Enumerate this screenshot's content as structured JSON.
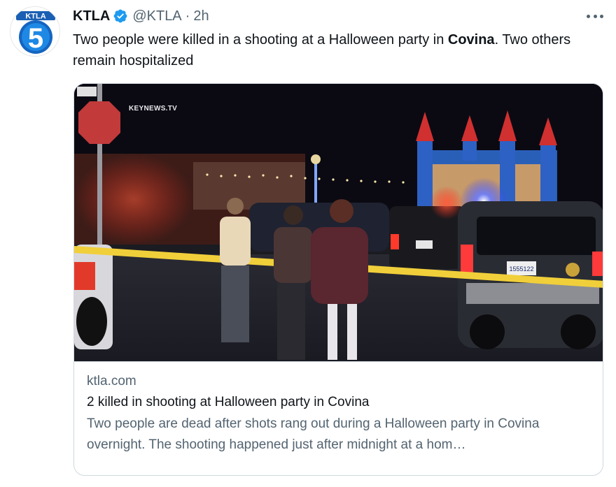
{
  "tweet": {
    "author_name": "KTLA",
    "handle": "@KTLA",
    "separator": "·",
    "time": "2h",
    "verified_icon": "verified-badge-icon",
    "avatar_text": "KTLA",
    "avatar_number": "5",
    "text_before": "Two people were killed in a shooting at a Halloween party in ",
    "text_bold": "Covina",
    "text_after": ". Two others remain hospitalized"
  },
  "card": {
    "watermark": "KEYNEWS.TV",
    "domain": "ktla.com",
    "title": "2 killed in shooting at Halloween party in Covina",
    "description": "Two people are dead after shots rang out during a Halloween party in Covina overnight. The shooting happened just after midnight at a hom…"
  },
  "colors": {
    "verified_blue": "#1d9bf0",
    "secondary_text": "#536471",
    "border": "#cfd9de"
  }
}
